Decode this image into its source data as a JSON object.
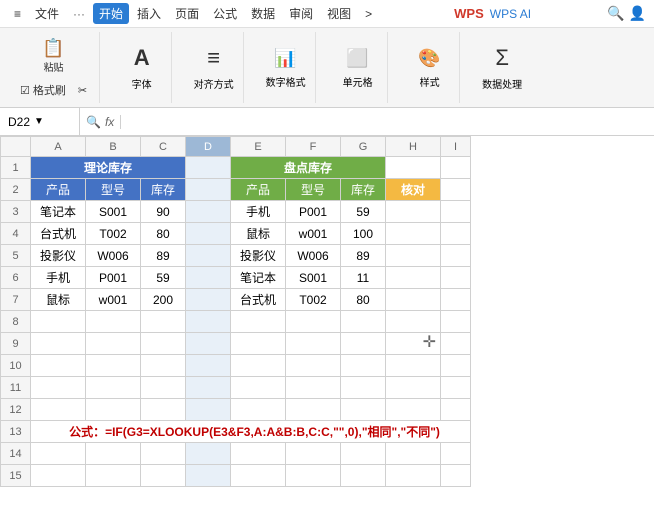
{
  "titlebar": {
    "menu_items": [
      "≡",
      "文件",
      "···",
      "开始",
      "插入",
      "页面",
      "公式",
      "数据",
      "审阅",
      "视图",
      ">"
    ],
    "active_tab": "开始",
    "app_name": "WPS AI"
  },
  "ribbon": {
    "groups": [
      {
        "label": "格式刷",
        "items": [
          "格式刷",
          "粘贴"
        ]
      },
      {
        "label": "字体",
        "icon": "A"
      },
      {
        "label": "对齐方式",
        "icon": "≡"
      },
      {
        "label": "数字格式",
        "icon": "1≡"
      },
      {
        "label": "单元格",
        "icon": "□"
      },
      {
        "label": "样式",
        "icon": "◩"
      },
      {
        "label": "数据处理",
        "icon": "Σ"
      }
    ]
  },
  "formula_bar": {
    "cell_ref": "D22",
    "formula": ""
  },
  "columns": [
    "",
    "A",
    "B",
    "C",
    "D",
    "E",
    "F",
    "G",
    "H",
    "I"
  ],
  "rows": [
    {
      "num": "1",
      "cells": {
        "A": {
          "value": "理论库存",
          "colspan": 3,
          "class": "header-blue"
        },
        "D": {
          "value": "",
          "class": "selected-col"
        },
        "E": {
          "value": "盘点库存",
          "colspan": 3,
          "class": "header-green"
        },
        "H": {
          "value": "",
          "class": ""
        },
        "I": {
          "value": "",
          "class": ""
        }
      }
    },
    {
      "num": "2",
      "cells": {
        "A": {
          "value": "产品",
          "class": "sub-header-blue"
        },
        "B": {
          "value": "型号",
          "class": "sub-header-blue"
        },
        "C": {
          "value": "库存",
          "class": "sub-header-blue"
        },
        "D": {
          "value": "",
          "class": "selected-col"
        },
        "E": {
          "value": "产品",
          "class": "sub-header-green"
        },
        "F": {
          "value": "型号",
          "class": "sub-header-green"
        },
        "G": {
          "value": "库存",
          "class": "sub-header-green"
        },
        "H": {
          "value": "核对",
          "class": "cell-orange"
        },
        "I": {
          "value": "",
          "class": ""
        }
      }
    },
    {
      "num": "3",
      "cells": {
        "A": {
          "value": "笔记本",
          "class": ""
        },
        "B": {
          "value": "S001",
          "class": ""
        },
        "C": {
          "value": "90",
          "class": ""
        },
        "D": {
          "value": "",
          "class": "selected-col"
        },
        "E": {
          "value": "手机",
          "class": ""
        },
        "F": {
          "value": "P001",
          "class": ""
        },
        "G": {
          "value": "59",
          "class": ""
        },
        "H": {
          "value": "",
          "class": ""
        },
        "I": {
          "value": "",
          "class": ""
        }
      }
    },
    {
      "num": "4",
      "cells": {
        "A": {
          "value": "台式机",
          "class": ""
        },
        "B": {
          "value": "T002",
          "class": ""
        },
        "C": {
          "value": "80",
          "class": ""
        },
        "D": {
          "value": "",
          "class": "selected-col"
        },
        "E": {
          "value": "鼠标",
          "class": ""
        },
        "F": {
          "value": "w001",
          "class": ""
        },
        "G": {
          "value": "100",
          "class": ""
        },
        "H": {
          "value": "",
          "class": ""
        },
        "I": {
          "value": "",
          "class": ""
        }
      }
    },
    {
      "num": "5",
      "cells": {
        "A": {
          "value": "投影仪",
          "class": ""
        },
        "B": {
          "value": "W006",
          "class": ""
        },
        "C": {
          "value": "89",
          "class": ""
        },
        "D": {
          "value": "",
          "class": "selected-col"
        },
        "E": {
          "value": "投影仪",
          "class": ""
        },
        "F": {
          "value": "W006",
          "class": ""
        },
        "G": {
          "value": "89",
          "class": ""
        },
        "H": {
          "value": "",
          "class": ""
        },
        "I": {
          "value": "",
          "class": ""
        }
      }
    },
    {
      "num": "6",
      "cells": {
        "A": {
          "value": "手机",
          "class": ""
        },
        "B": {
          "value": "P001",
          "class": ""
        },
        "C": {
          "value": "59",
          "class": ""
        },
        "D": {
          "value": "",
          "class": "selected-col"
        },
        "E": {
          "value": "笔记本",
          "class": ""
        },
        "F": {
          "value": "S001",
          "class": ""
        },
        "G": {
          "value": "11",
          "class": ""
        },
        "H": {
          "value": "",
          "class": ""
        },
        "I": {
          "value": "",
          "class": ""
        }
      }
    },
    {
      "num": "7",
      "cells": {
        "A": {
          "value": "鼠标",
          "class": ""
        },
        "B": {
          "value": "w001",
          "class": ""
        },
        "C": {
          "value": "200",
          "class": ""
        },
        "D": {
          "value": "",
          "class": "selected-col"
        },
        "E": {
          "value": "台式机",
          "class": ""
        },
        "F": {
          "value": "T002",
          "class": ""
        },
        "G": {
          "value": "80",
          "class": ""
        },
        "H": {
          "value": "",
          "class": ""
        },
        "I": {
          "value": "",
          "class": ""
        }
      }
    },
    {
      "num": "8",
      "empty": true
    },
    {
      "num": "9",
      "empty": true
    },
    {
      "num": "10",
      "empty": true
    },
    {
      "num": "11",
      "empty": true
    },
    {
      "num": "12",
      "empty": true
    },
    {
      "num": "13",
      "formula_row": true,
      "formula": "公式：=IF(G3=XLOOKUP(E3&F3,A:A&B:B,C:C,\"\",0),\"相同\",\"不同\")"
    },
    {
      "num": "14",
      "empty": true
    },
    {
      "num": "15",
      "empty": true
    }
  ]
}
